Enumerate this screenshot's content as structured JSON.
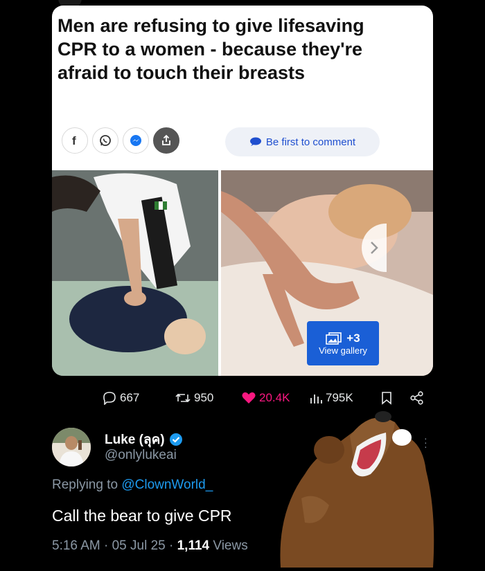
{
  "article": {
    "headline": "Men are refusing to give lifesaving CPR to a women - because they're afraid to touch their breasts",
    "comment_pill": "Be first to comment",
    "gallery_count": "+3",
    "gallery_label": "View gallery",
    "share_icons": [
      "facebook-icon",
      "whatsapp-icon",
      "messenger-icon",
      "share-icon"
    ]
  },
  "quoted_actions": {
    "replies": "667",
    "reposts": "950",
    "likes": "20.4K",
    "views": "795K",
    "like_color": "#f91880"
  },
  "reply": {
    "name": "Luke (ลุค)",
    "handle": "@onlylukeai",
    "replying_prefix": "Replying to",
    "replying_to": "@ClownWorld_",
    "text": "Call the bear to give CPR",
    "time": "5:16 AM · 05 Jul 25 · ",
    "views_count": "1,114",
    "views_label": " Views",
    "verified_color": "#1d9bf0"
  }
}
